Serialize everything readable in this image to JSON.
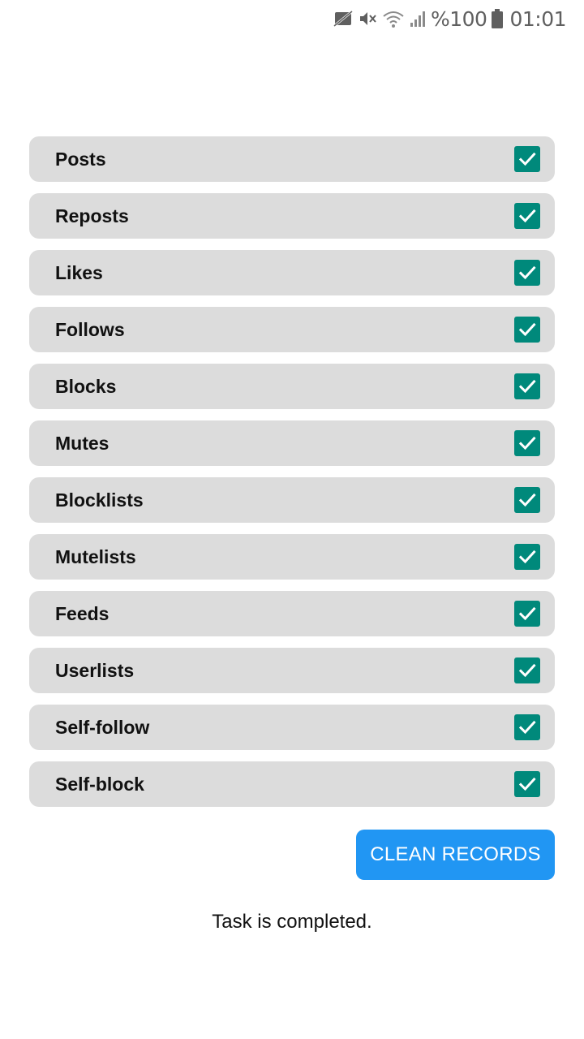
{
  "status_bar": {
    "battery_text": "%100",
    "time": "01:01",
    "icons": [
      "no-sim-icon",
      "vibrate-mute-icon",
      "wifi-icon",
      "signal-icon",
      "battery-icon"
    ]
  },
  "options": [
    {
      "label": "Posts",
      "checked": true
    },
    {
      "label": "Reposts",
      "checked": true
    },
    {
      "label": "Likes",
      "checked": true
    },
    {
      "label": "Follows",
      "checked": true
    },
    {
      "label": "Blocks",
      "checked": true
    },
    {
      "label": "Mutes",
      "checked": true
    },
    {
      "label": "Blocklists",
      "checked": true
    },
    {
      "label": "Mutelists",
      "checked": true
    },
    {
      "label": "Feeds",
      "checked": true
    },
    {
      "label": "Userlists",
      "checked": true
    },
    {
      "label": "Self-follow",
      "checked": true
    },
    {
      "label": "Self-block",
      "checked": true
    }
  ],
  "actions": {
    "clean_label": "CLEAN RECORDS"
  },
  "status": {
    "message": "Task is completed."
  },
  "colors": {
    "checkbox_checked": "#00897b",
    "button_primary": "#2196f3",
    "row_background": "#dcdcdc"
  }
}
